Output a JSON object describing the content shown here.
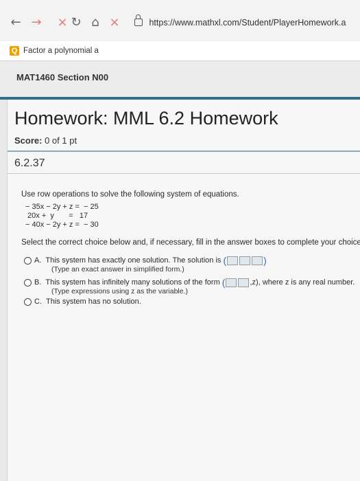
{
  "browser": {
    "back_icon": "arrow-left-icon",
    "forward_icon": "arrow-right-icon",
    "refresh_icon": "refresh-icon",
    "home_icon": "home-icon",
    "close_icon": "x-icon",
    "url": "https://www.mathxl.com/Student/PlayerHomework.a"
  },
  "search": {
    "icon": "search-icon",
    "text": "Factor a polynomial a"
  },
  "course": {
    "title": "MAT1460 Section N00"
  },
  "homework": {
    "title": "Homework: MML 6.2 Homework",
    "score_label": "Score:",
    "score_value": "0 of 1 pt",
    "question_id": "6.2.37"
  },
  "question": {
    "instructions": "Use row operations to solve the following system of equations.",
    "equations": [
      "− 35x − 2y + z =  − 25",
      " 20x +  y       =   17",
      "− 40x − 2y + z =  − 30"
    ],
    "select_prompt": "Select the correct choice below and, if necessary, fill in the answer boxes to complete your choice."
  },
  "choices": {
    "a": {
      "letter": "A.",
      "text": "This system has exactly one solution. The solution is",
      "hint": "(Type an exact answer in simplified form.)"
    },
    "b": {
      "letter": "B.",
      "text": "This system has infinitely many solutions of the form",
      "tail": ",z), where z is any real number.",
      "hint": "(Type expressions using z as the variable.)"
    },
    "c": {
      "letter": "C.",
      "text": "This system has no solution."
    }
  },
  "colors": {
    "accent": "#2f6f8b",
    "answer_box": "#dfe7ef"
  }
}
